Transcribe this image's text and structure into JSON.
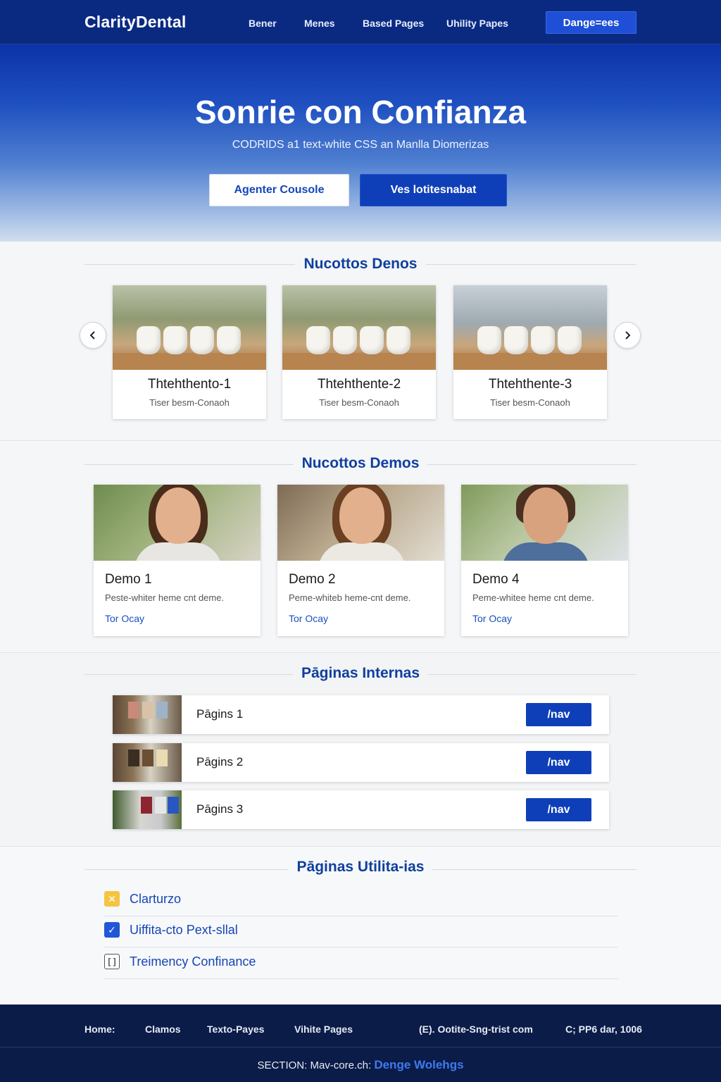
{
  "nav": {
    "brand": "ClarityDental",
    "links": [
      "Bener",
      "Menes",
      "Based Pages",
      "Uhility Papes"
    ],
    "cta": "Dange=ees"
  },
  "hero": {
    "title": "Sonrie con Confianza",
    "subtitle": "CODRIDS a1 text-white CSS an Manlla Diomerizas",
    "primary_button": "Agenter Cousole",
    "secondary_button": "Ves lotitesnabat"
  },
  "treatments": {
    "title": "Nucottos Denos",
    "prev_icon": "chevron-left-icon",
    "next_icon": "chevron-right-icon",
    "items": [
      {
        "title": "Thtehthento-1",
        "subtitle": "Tiser besm-Conaoh"
      },
      {
        "title": "Thtehthente-2",
        "subtitle": "Tiser besm-Conaoh"
      },
      {
        "title": "Thtehthente-3",
        "subtitle": "Tiser besm-Conaoh"
      }
    ]
  },
  "demos": {
    "title": "Nucottos Demos",
    "items": [
      {
        "title": "Demo 1",
        "desc": "Peste-whiter heme cnt deme.",
        "link": "Tor Ocay"
      },
      {
        "title": "Demo 2",
        "desc": "Peme-whiteb heme-cnt deme.",
        "link": "Tor Ocay"
      },
      {
        "title": "Demo 4",
        "desc": "Peme-whitee heme cnt deme.",
        "link": "Tor Ocay"
      }
    ]
  },
  "internal_pages": {
    "title": "Pāginas Internas",
    "items": [
      {
        "label": "Pāgins 1",
        "button": "/nav"
      },
      {
        "label": "Pāgins 2",
        "button": "/nav"
      },
      {
        "label": "Pāgins 3",
        "button": "/nav"
      }
    ]
  },
  "utility_pages": {
    "title": "Pāginas Utilita-ias",
    "items": [
      {
        "label": "Clarturzo",
        "icon": "warning-icon",
        "color": "#f4c542"
      },
      {
        "label": "Uiffita-cto Pext-sllal",
        "icon": "checkbox-checked-icon",
        "color": "#1f57d6"
      },
      {
        "label": "Treimency Confinance",
        "icon": "document-icon",
        "color": "#ffffff"
      }
    ]
  },
  "footer": {
    "links": [
      "Home:",
      "Clamos",
      "Texto-Payes",
      "Vihite Pages",
      "(E). Ootite-Sng-trist com",
      "C; PP6 dar, 1006"
    ],
    "bottom_prefix": "SECTION: Mav-core.ch:",
    "bottom_brand": "Denge Wolehgs"
  },
  "colors": {
    "primary": "#0f3fb8",
    "nav_bg": "#0a2a82",
    "footer_bg": "#0b1c48",
    "heading": "#0f3f9e"
  }
}
